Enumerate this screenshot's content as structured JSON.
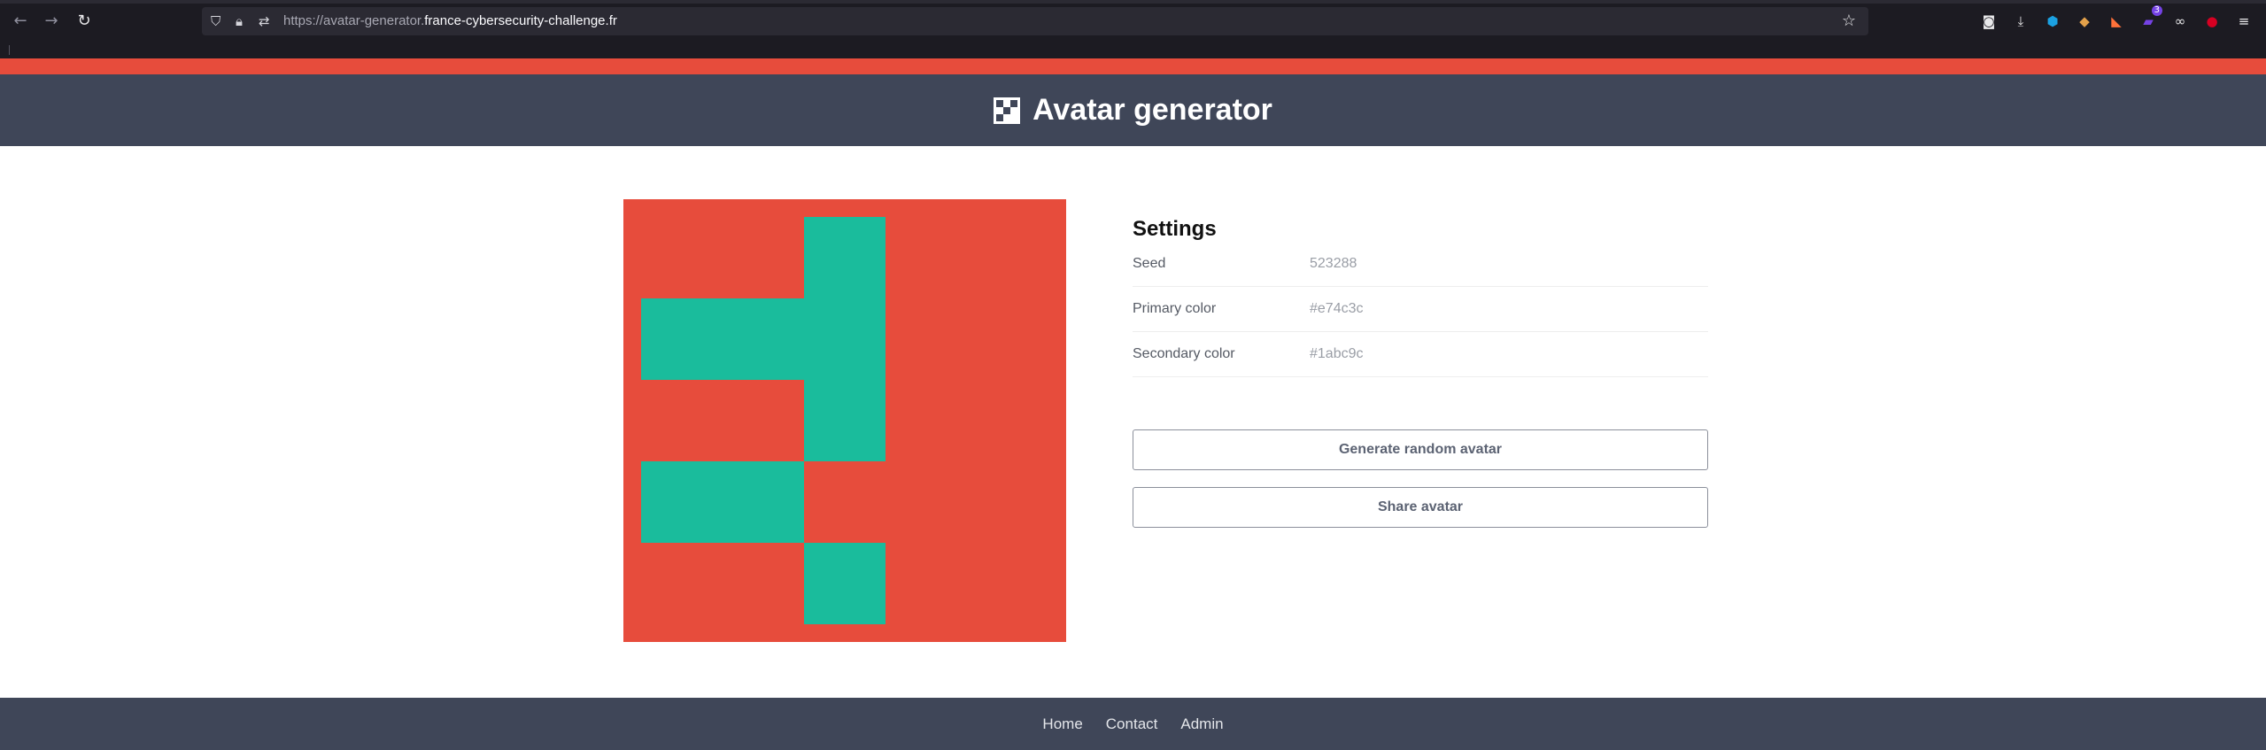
{
  "browser": {
    "back_icon": "←",
    "forward_icon": "→",
    "reload_icon": "↻",
    "url_prefix": "https://avatar-generator.",
    "url_domain": "france-cybersecurity-challenge.fr",
    "bookmark_icon": "☆",
    "extension_badge": "3"
  },
  "header": {
    "title": "Avatar generator"
  },
  "avatar": {
    "primary_color": "#e74c3c",
    "secondary_color": "#1abc9c",
    "grid_size": 5,
    "filled_cells": [
      [
        2,
        0
      ],
      [
        0,
        1
      ],
      [
        1,
        1
      ],
      [
        2,
        1
      ],
      [
        2,
        2
      ],
      [
        0,
        3
      ],
      [
        1,
        3
      ],
      [
        2,
        4
      ]
    ]
  },
  "settings": {
    "title": "Settings",
    "rows": [
      {
        "label": "Seed",
        "value": "523288"
      },
      {
        "label": "Primary color",
        "value": "#e74c3c"
      },
      {
        "label": "Secondary color",
        "value": "#1abc9c"
      }
    ],
    "generate_label": "Generate random avatar",
    "share_label": "Share avatar"
  },
  "footer": {
    "links": [
      "Home",
      "Contact",
      "Admin"
    ]
  }
}
